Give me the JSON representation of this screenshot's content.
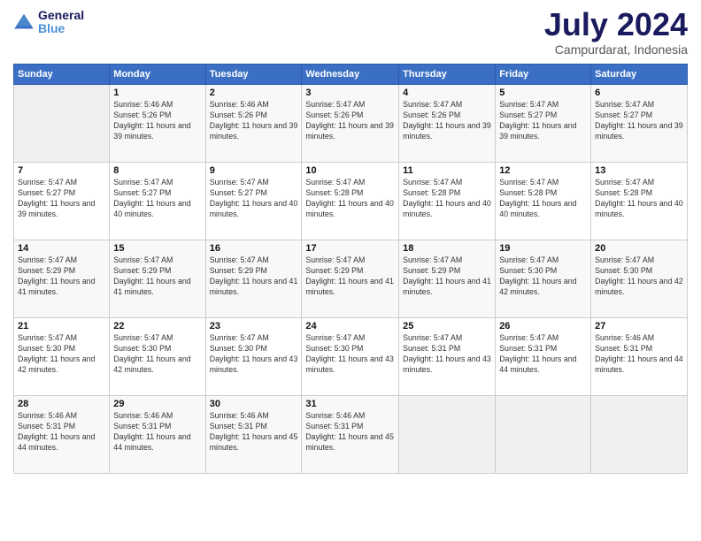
{
  "logo": {
    "text_general": "General",
    "text_blue": "Blue"
  },
  "title": {
    "month_year": "July 2024",
    "location": "Campurdarat, Indonesia"
  },
  "header_days": [
    "Sunday",
    "Monday",
    "Tuesday",
    "Wednesday",
    "Thursday",
    "Friday",
    "Saturday"
  ],
  "weeks": [
    [
      {
        "day": "",
        "sunrise": "",
        "sunset": "",
        "daylight": ""
      },
      {
        "day": "1",
        "sunrise": "Sunrise: 5:46 AM",
        "sunset": "Sunset: 5:26 PM",
        "daylight": "Daylight: 11 hours and 39 minutes."
      },
      {
        "day": "2",
        "sunrise": "Sunrise: 5:46 AM",
        "sunset": "Sunset: 5:26 PM",
        "daylight": "Daylight: 11 hours and 39 minutes."
      },
      {
        "day": "3",
        "sunrise": "Sunrise: 5:47 AM",
        "sunset": "Sunset: 5:26 PM",
        "daylight": "Daylight: 11 hours and 39 minutes."
      },
      {
        "day": "4",
        "sunrise": "Sunrise: 5:47 AM",
        "sunset": "Sunset: 5:26 PM",
        "daylight": "Daylight: 11 hours and 39 minutes."
      },
      {
        "day": "5",
        "sunrise": "Sunrise: 5:47 AM",
        "sunset": "Sunset: 5:27 PM",
        "daylight": "Daylight: 11 hours and 39 minutes."
      },
      {
        "day": "6",
        "sunrise": "Sunrise: 5:47 AM",
        "sunset": "Sunset: 5:27 PM",
        "daylight": "Daylight: 11 hours and 39 minutes."
      }
    ],
    [
      {
        "day": "7",
        "sunrise": "Sunrise: 5:47 AM",
        "sunset": "Sunset: 5:27 PM",
        "daylight": "Daylight: 11 hours and 39 minutes."
      },
      {
        "day": "8",
        "sunrise": "Sunrise: 5:47 AM",
        "sunset": "Sunset: 5:27 PM",
        "daylight": "Daylight: 11 hours and 40 minutes."
      },
      {
        "day": "9",
        "sunrise": "Sunrise: 5:47 AM",
        "sunset": "Sunset: 5:27 PM",
        "daylight": "Daylight: 11 hours and 40 minutes."
      },
      {
        "day": "10",
        "sunrise": "Sunrise: 5:47 AM",
        "sunset": "Sunset: 5:28 PM",
        "daylight": "Daylight: 11 hours and 40 minutes."
      },
      {
        "day": "11",
        "sunrise": "Sunrise: 5:47 AM",
        "sunset": "Sunset: 5:28 PM",
        "daylight": "Daylight: 11 hours and 40 minutes."
      },
      {
        "day": "12",
        "sunrise": "Sunrise: 5:47 AM",
        "sunset": "Sunset: 5:28 PM",
        "daylight": "Daylight: 11 hours and 40 minutes."
      },
      {
        "day": "13",
        "sunrise": "Sunrise: 5:47 AM",
        "sunset": "Sunset: 5:28 PM",
        "daylight": "Daylight: 11 hours and 40 minutes."
      }
    ],
    [
      {
        "day": "14",
        "sunrise": "Sunrise: 5:47 AM",
        "sunset": "Sunset: 5:29 PM",
        "daylight": "Daylight: 11 hours and 41 minutes."
      },
      {
        "day": "15",
        "sunrise": "Sunrise: 5:47 AM",
        "sunset": "Sunset: 5:29 PM",
        "daylight": "Daylight: 11 hours and 41 minutes."
      },
      {
        "day": "16",
        "sunrise": "Sunrise: 5:47 AM",
        "sunset": "Sunset: 5:29 PM",
        "daylight": "Daylight: 11 hours and 41 minutes."
      },
      {
        "day": "17",
        "sunrise": "Sunrise: 5:47 AM",
        "sunset": "Sunset: 5:29 PM",
        "daylight": "Daylight: 11 hours and 41 minutes."
      },
      {
        "day": "18",
        "sunrise": "Sunrise: 5:47 AM",
        "sunset": "Sunset: 5:29 PM",
        "daylight": "Daylight: 11 hours and 41 minutes."
      },
      {
        "day": "19",
        "sunrise": "Sunrise: 5:47 AM",
        "sunset": "Sunset: 5:30 PM",
        "daylight": "Daylight: 11 hours and 42 minutes."
      },
      {
        "day": "20",
        "sunrise": "Sunrise: 5:47 AM",
        "sunset": "Sunset: 5:30 PM",
        "daylight": "Daylight: 11 hours and 42 minutes."
      }
    ],
    [
      {
        "day": "21",
        "sunrise": "Sunrise: 5:47 AM",
        "sunset": "Sunset: 5:30 PM",
        "daylight": "Daylight: 11 hours and 42 minutes."
      },
      {
        "day": "22",
        "sunrise": "Sunrise: 5:47 AM",
        "sunset": "Sunset: 5:30 PM",
        "daylight": "Daylight: 11 hours and 42 minutes."
      },
      {
        "day": "23",
        "sunrise": "Sunrise: 5:47 AM",
        "sunset": "Sunset: 5:30 PM",
        "daylight": "Daylight: 11 hours and 43 minutes."
      },
      {
        "day": "24",
        "sunrise": "Sunrise: 5:47 AM",
        "sunset": "Sunset: 5:30 PM",
        "daylight": "Daylight: 11 hours and 43 minutes."
      },
      {
        "day": "25",
        "sunrise": "Sunrise: 5:47 AM",
        "sunset": "Sunset: 5:31 PM",
        "daylight": "Daylight: 11 hours and 43 minutes."
      },
      {
        "day": "26",
        "sunrise": "Sunrise: 5:47 AM",
        "sunset": "Sunset: 5:31 PM",
        "daylight": "Daylight: 11 hours and 44 minutes."
      },
      {
        "day": "27",
        "sunrise": "Sunrise: 5:46 AM",
        "sunset": "Sunset: 5:31 PM",
        "daylight": "Daylight: 11 hours and 44 minutes."
      }
    ],
    [
      {
        "day": "28",
        "sunrise": "Sunrise: 5:46 AM",
        "sunset": "Sunset: 5:31 PM",
        "daylight": "Daylight: 11 hours and 44 minutes."
      },
      {
        "day": "29",
        "sunrise": "Sunrise: 5:46 AM",
        "sunset": "Sunset: 5:31 PM",
        "daylight": "Daylight: 11 hours and 44 minutes."
      },
      {
        "day": "30",
        "sunrise": "Sunrise: 5:46 AM",
        "sunset": "Sunset: 5:31 PM",
        "daylight": "Daylight: 11 hours and 45 minutes."
      },
      {
        "day": "31",
        "sunrise": "Sunrise: 5:46 AM",
        "sunset": "Sunset: 5:31 PM",
        "daylight": "Daylight: 11 hours and 45 minutes."
      },
      {
        "day": "",
        "sunrise": "",
        "sunset": "",
        "daylight": ""
      },
      {
        "day": "",
        "sunrise": "",
        "sunset": "",
        "daylight": ""
      },
      {
        "day": "",
        "sunrise": "",
        "sunset": "",
        "daylight": ""
      }
    ]
  ]
}
